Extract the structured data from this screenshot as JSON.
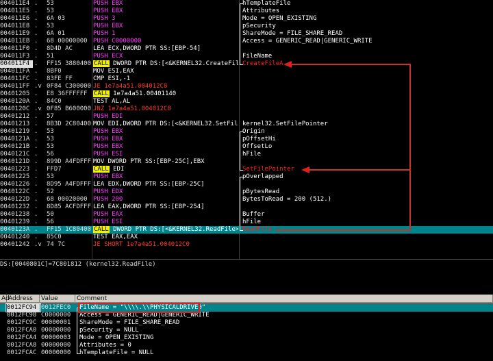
{
  "disasm": {
    "rows": [
      {
        "addr": "004011E4",
        "mark": ".",
        "hex": "53",
        "asm": [
          {
            "t": "PUSH EBX",
            "k": "push"
          }
        ],
        "cmt": "hTemplateFile",
        "brace": "start"
      },
      {
        "addr": "004011E5",
        "mark": ".",
        "hex": "53",
        "asm": [
          {
            "t": "PUSH EBX",
            "k": "push"
          }
        ],
        "cmt": "Attributes"
      },
      {
        "addr": "004011E6",
        "mark": ".",
        "hex": "6A 03",
        "asm": [
          {
            "t": "PUSH 3",
            "k": "push"
          }
        ],
        "cmt": "Mode = OPEN_EXISTING"
      },
      {
        "addr": "004011E8",
        "mark": ".",
        "hex": "53",
        "asm": [
          {
            "t": "PUSH EBX",
            "k": "push"
          }
        ],
        "cmt": "pSecurity"
      },
      {
        "addr": "004011E9",
        "mark": ".",
        "hex": "6A 01",
        "asm": [
          {
            "t": "PUSH 1",
            "k": "push"
          }
        ],
        "cmt": "ShareMode = FILE_SHARE_READ"
      },
      {
        "addr": "004011EB",
        "mark": ".",
        "hex": "68 00000000",
        "asm": [
          {
            "t": "PUSH C0000000",
            "k": "push"
          }
        ],
        "cmt": "Access = GENERIC_READ|GENERIC_WRITE"
      },
      {
        "addr": "004011F0",
        "mark": ".",
        "hex": "8D4D AC",
        "asm": [
          {
            "t": "LEA ECX,DWORD PTR SS:[EBP-54]",
            "k": "std"
          }
        ],
        "cmt": ""
      },
      {
        "addr": "004011F3",
        "mark": ".",
        "hex": "51",
        "asm": [
          {
            "t": "PUSH ECX",
            "k": "push"
          }
        ],
        "cmt": "FileName"
      },
      {
        "addr": "004011F4",
        "mark": ".",
        "hex": "FF15 3880400",
        "asm": [
          {
            "t": "CALL",
            "k": "call"
          },
          {
            "t": " DWORD PTR DS:[<&KERNEL32.CreateFil",
            "k": "std"
          }
        ],
        "cmt": "CreateFileA",
        "cmtRed": true,
        "brace": "end",
        "cur": true
      },
      {
        "addr": "004011FA",
        "mark": ".",
        "hex": "8BF0",
        "asm": [
          {
            "t": "MOV ESI,EAX",
            "k": "std"
          }
        ],
        "cmt": ""
      },
      {
        "addr": "004011FC",
        "mark": ".",
        "hex": "83FE FF",
        "asm": [
          {
            "t": "CMP ESI,-1",
            "k": "std"
          }
        ],
        "cmt": ""
      },
      {
        "addr": "004011FF",
        "mark": ".v",
        "hex": "0F84 C300000",
        "asm": [
          {
            "t": "JE 1e7a4a51.004012C8",
            "k": "jump"
          }
        ],
        "cmt": ""
      },
      {
        "addr": "00401205",
        "mark": ".",
        "hex": "E8 36FFFFFF",
        "asm": [
          {
            "t": "CALL",
            "k": "call"
          },
          {
            "t": " 1e7a4a51.00401140",
            "k": "std"
          }
        ],
        "cmt": ""
      },
      {
        "addr": "0040120A",
        "mark": ".",
        "hex": "84C0",
        "asm": [
          {
            "t": "TEST AL,AL",
            "k": "std"
          }
        ],
        "cmt": ""
      },
      {
        "addr": "0040120C",
        "mark": ".v",
        "hex": "0F85 B600000",
        "asm": [
          {
            "t": "JNZ 1e7a4a51.004012C8",
            "k": "jump"
          }
        ],
        "cmt": ""
      },
      {
        "addr": "00401212",
        "mark": ".",
        "hex": "57",
        "asm": [
          {
            "t": "PUSH EDI",
            "k": "push"
          }
        ],
        "cmt": ""
      },
      {
        "addr": "00401213",
        "mark": ".",
        "hex": "8B3D 2C80400",
        "asm": [
          {
            "t": "MOV EDI,DWORD PTR DS:[<&KERNEL32.SetFil",
            "k": "std"
          }
        ],
        "cmt": "kernel32.SetFilePointer"
      },
      {
        "addr": "00401219",
        "mark": ".",
        "hex": "53",
        "asm": [
          {
            "t": "PUSH EBX",
            "k": "push"
          }
        ],
        "cmt": "Origin",
        "brace": "start"
      },
      {
        "addr": "0040121A",
        "mark": ".",
        "hex": "53",
        "asm": [
          {
            "t": "PUSH EBX",
            "k": "push"
          }
        ],
        "cmt": "pOffsetHi"
      },
      {
        "addr": "0040121B",
        "mark": ".",
        "hex": "53",
        "asm": [
          {
            "t": "PUSH EBX",
            "k": "push"
          }
        ],
        "cmt": "OffsetLo"
      },
      {
        "addr": "0040121C",
        "mark": ".",
        "hex": "56",
        "asm": [
          {
            "t": "PUSH ESI",
            "k": "push"
          }
        ],
        "cmt": "hFile"
      },
      {
        "addr": "0040121D",
        "mark": ".",
        "hex": "899D A4FDFFFF",
        "asm": [
          {
            "t": "MOV DWORD PTR SS:[EBP-25C],EBX",
            "k": "std"
          }
        ],
        "cmt": ""
      },
      {
        "addr": "00401223",
        "mark": ".",
        "hex": "FFD7",
        "asm": [
          {
            "t": "CALL",
            "k": "call"
          },
          {
            "t": " EDI",
            "k": "std"
          }
        ],
        "cmt": "SetFilePointer",
        "cmtRed": true,
        "brace": "end"
      },
      {
        "addr": "00401225",
        "mark": ".",
        "hex": "53",
        "asm": [
          {
            "t": "PUSH EBX",
            "k": "push"
          }
        ],
        "cmt": "pOverlapped",
        "brace": "start"
      },
      {
        "addr": "00401226",
        "mark": ".",
        "hex": "8D95 A4FDFFFF",
        "asm": [
          {
            "t": "LEA EDX,DWORD PTR SS:[EBP-25C]",
            "k": "std"
          }
        ],
        "cmt": ""
      },
      {
        "addr": "0040122C",
        "mark": ".",
        "hex": "52",
        "asm": [
          {
            "t": "PUSH EDX",
            "k": "push"
          }
        ],
        "cmt": "pBytesRead"
      },
      {
        "addr": "0040122D",
        "mark": ".",
        "hex": "68 00020000",
        "asm": [
          {
            "t": "PUSH 200",
            "k": "push"
          }
        ],
        "cmt": "BytesToRead = 200 (512.)"
      },
      {
        "addr": "00401232",
        "mark": ".",
        "hex": "8D85 ACFDFFFF",
        "asm": [
          {
            "t": "LEA EAX,DWORD PTR SS:[EBP-254]",
            "k": "std"
          }
        ],
        "cmt": ""
      },
      {
        "addr": "00401238",
        "mark": ".",
        "hex": "50",
        "asm": [
          {
            "t": "PUSH EAX",
            "k": "push"
          }
        ],
        "cmt": "Buffer"
      },
      {
        "addr": "00401239",
        "mark": ".",
        "hex": "56",
        "asm": [
          {
            "t": "PUSH ESI",
            "k": "push"
          }
        ],
        "cmt": "hFile"
      },
      {
        "addr": "0040123A",
        "mark": ".",
        "hex": "FF15 1C80400",
        "asm": [
          {
            "t": "CALL",
            "k": "call"
          },
          {
            "t": " DWORD PTR DS:[<&KERNEL32.ReadFile>]",
            "k": "std"
          }
        ],
        "cmt": "ReadFile",
        "cmtRed": true,
        "brace": "end",
        "selected": true
      },
      {
        "addr": "00401240",
        "mark": ".",
        "hex": "85C0",
        "asm": [
          {
            "t": "TEST EAX,EAX",
            "k": "std"
          }
        ],
        "cmt": ""
      },
      {
        "addr": "00401242",
        "mark": ".v",
        "hex": "74 7C",
        "asm": [
          {
            "t": "JE SHORT 1e7a4a51.004012C0",
            "k": "jump"
          }
        ],
        "cmt": ""
      }
    ]
  },
  "info": {
    "line": "DS:[0040801C]=7C801812 (kernel32.ReadFile)"
  },
  "stack": {
    "headers": {
      "gutter": "Ad",
      "address": "Address",
      "value": "Value",
      "comment": "Comment"
    },
    "rows": [
      {
        "addr": "0012FC94",
        "val": "0012FEC0",
        "cmt": "FileName = \"\\\\\\\\.\\\\PHYSICALDRIVE0\"",
        "brace": "start",
        "selected": true
      },
      {
        "addr": "0012FC98",
        "val": "C0000000",
        "cmt": "Access = GENERIC_READ|GENERIC_WRITE"
      },
      {
        "addr": "0012FC9C",
        "val": "00000001",
        "cmt": "ShareMode = FILE_SHARE_READ"
      },
      {
        "addr": "0012FCA0",
        "val": "00000000",
        "cmt": "pSecurity = NULL"
      },
      {
        "addr": "0012FCA4",
        "val": "00000003",
        "cmt": "Mode = OPEN_EXISTING"
      },
      {
        "addr": "0012FCA8",
        "val": "00000000",
        "cmt": "Attributes = 0"
      },
      {
        "addr": "0012FCAC",
        "val": "00000000",
        "cmt": "hTemplateFile = NULL",
        "brace": "end"
      }
    ]
  },
  "colors": {
    "push": "#ff3dff",
    "jump": "#ff3a2a",
    "call_bg": "#f3f300",
    "selection": "#00848c",
    "annotation": "#e02020"
  }
}
